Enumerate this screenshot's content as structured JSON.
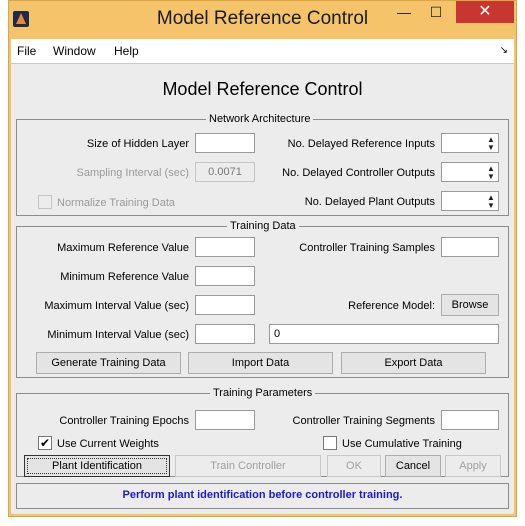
{
  "window": {
    "title": "Model Reference Control",
    "min_glyph": "—",
    "max_glyph": "☐",
    "close_glyph": "✕"
  },
  "menu": {
    "items": [
      "File",
      "Window",
      "Help"
    ],
    "dock_icon": "↘"
  },
  "main_title": "Model Reference Control",
  "network": {
    "title": "Network Architecture",
    "hidden_layer_label": "Size of Hidden Layer",
    "hidden_layer_value": "",
    "sampling_label": "Sampling Interval (sec)",
    "sampling_value": "0.0071",
    "normalize_label": "Normalize Training Data",
    "normalize_checked": false,
    "delayed_ref_label": "No. Delayed Reference Inputs",
    "delayed_ctrl_label": "No. Delayed Controller Outputs",
    "delayed_plant_label": "No. Delayed Plant Outputs"
  },
  "training_data": {
    "title": "Training Data",
    "max_ref_label": "Maximum Reference Value",
    "min_ref_label": "Minimum Reference Value",
    "max_int_label": "Maximum Interval Value (sec)",
    "min_int_label": "Minimum Interval Value (sec)",
    "ctrl_samples_label": "Controller Training Samples",
    "ref_model_label": "Reference Model:",
    "browse_label": "Browse",
    "ref_model_value": "0",
    "generate_label": "Generate Training Data",
    "import_label": "Import Data",
    "export_label": "Export Data"
  },
  "training_params": {
    "title": "Training Parameters",
    "epochs_label": "Controller Training Epochs",
    "segments_label": "Controller Training Segments",
    "current_weights_label": "Use Current Weights",
    "current_weights_checked": true,
    "cumulative_label": "Use Cumulative Training",
    "cumulative_checked": false,
    "plant_id_label": "Plant Identification",
    "train_label": "Train Controller",
    "ok_label": "OK",
    "cancel_label": "Cancel",
    "apply_label": "Apply"
  },
  "status": "Perform plant identification before controller training."
}
